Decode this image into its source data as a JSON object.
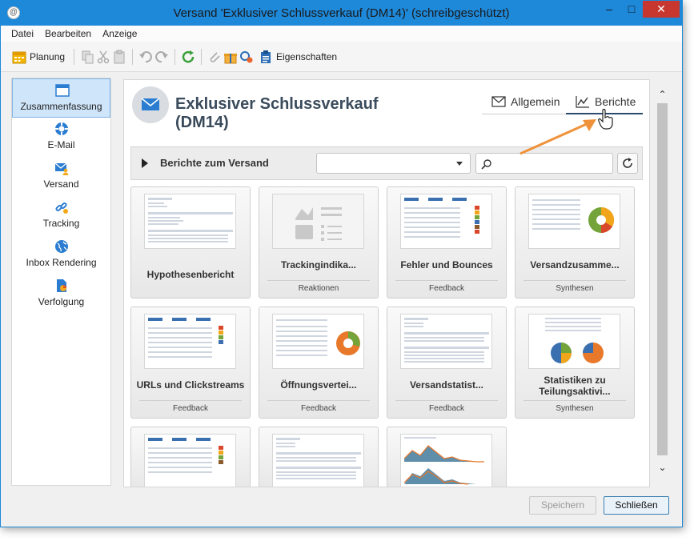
{
  "window": {
    "title": "Versand 'Exklusiver Schlussverkauf  (DM14)'  (schreibgeschützt)",
    "controls": [
      "minimize-icon",
      "maximize-icon",
      "close-icon"
    ],
    "accent": "#1e88d9"
  },
  "menu": [
    "Datei",
    "Bearbeiten",
    "Anzeige"
  ],
  "toolbar": {
    "planung_label": "Planung",
    "eigenschaften_label": "Eigenschaften"
  },
  "sidebar": {
    "items": [
      {
        "label": "Zusammenfassung",
        "icon": "window-icon",
        "active": true
      },
      {
        "label": "E-Mail",
        "icon": "lifebuoy-icon"
      },
      {
        "label": "Versand",
        "icon": "envelope-user-icon"
      },
      {
        "label": "Tracking",
        "icon": "link-icon"
      },
      {
        "label": "Inbox Rendering",
        "icon": "globe-icon"
      },
      {
        "label": "Verfolgung",
        "icon": "document-chart-icon"
      }
    ]
  },
  "header": {
    "title": "Exklusiver Schlussverkauf (DM14)",
    "tabs": [
      {
        "label": "Allgemein",
        "icon": "envelope-icon"
      },
      {
        "label": "Berichte",
        "icon": "line-chart-icon",
        "active": true
      }
    ]
  },
  "filter": {
    "label": "Berichte zum Versand",
    "select_value": "",
    "search_value": ""
  },
  "reports": [
    {
      "title": "Hypothesenbericht",
      "category": ""
    },
    {
      "title": "Trackingindika...",
      "category": "Reaktionen"
    },
    {
      "title": "Fehler und Bounces",
      "category": "Feedback"
    },
    {
      "title": "Versandzusamme...",
      "category": "Synthesen"
    },
    {
      "title": "URLs und Clickstreams",
      "category": "Feedback"
    },
    {
      "title": "Öffnungsvertei...",
      "category": "Feedback"
    },
    {
      "title": "Versandstatist...",
      "category": "Feedback"
    },
    {
      "title": "Statistiken zu Teilungsaktivi...",
      "category": "Synthesen"
    },
    {
      "title": "",
      "category": ""
    },
    {
      "title": "",
      "category": ""
    },
    {
      "title": "",
      "category": ""
    }
  ],
  "footer": {
    "save_label": "Speichern",
    "close_label": "Schließen"
  }
}
